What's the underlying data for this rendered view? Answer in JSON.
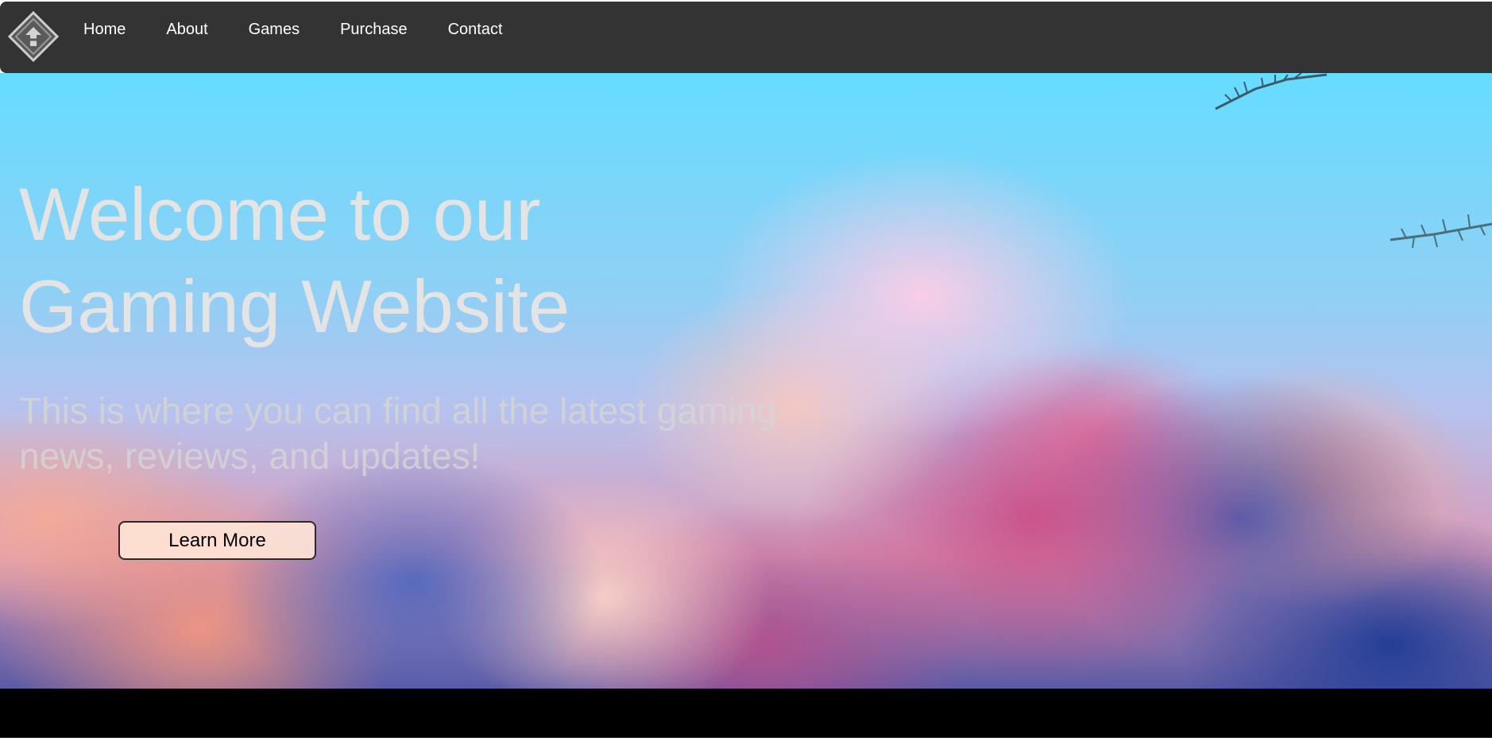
{
  "nav": {
    "logo_icon": "diamond-logo-icon",
    "links": [
      {
        "label": "Home"
      },
      {
        "label": "About"
      },
      {
        "label": "Games"
      },
      {
        "label": "Purchase"
      },
      {
        "label": "Contact"
      }
    ]
  },
  "hero": {
    "title": "Welcome to our Gaming Website",
    "subtitle": "This is where you can find all the latest gaming news, reviews, and updates!",
    "cta_label": "Learn More",
    "background": "pastel-cloud-sky-image"
  },
  "colors": {
    "navbar_bg": "#333333",
    "nav_text": "#ffffff",
    "title_text": "#e4e4e4",
    "footer_bg": "#000000"
  }
}
